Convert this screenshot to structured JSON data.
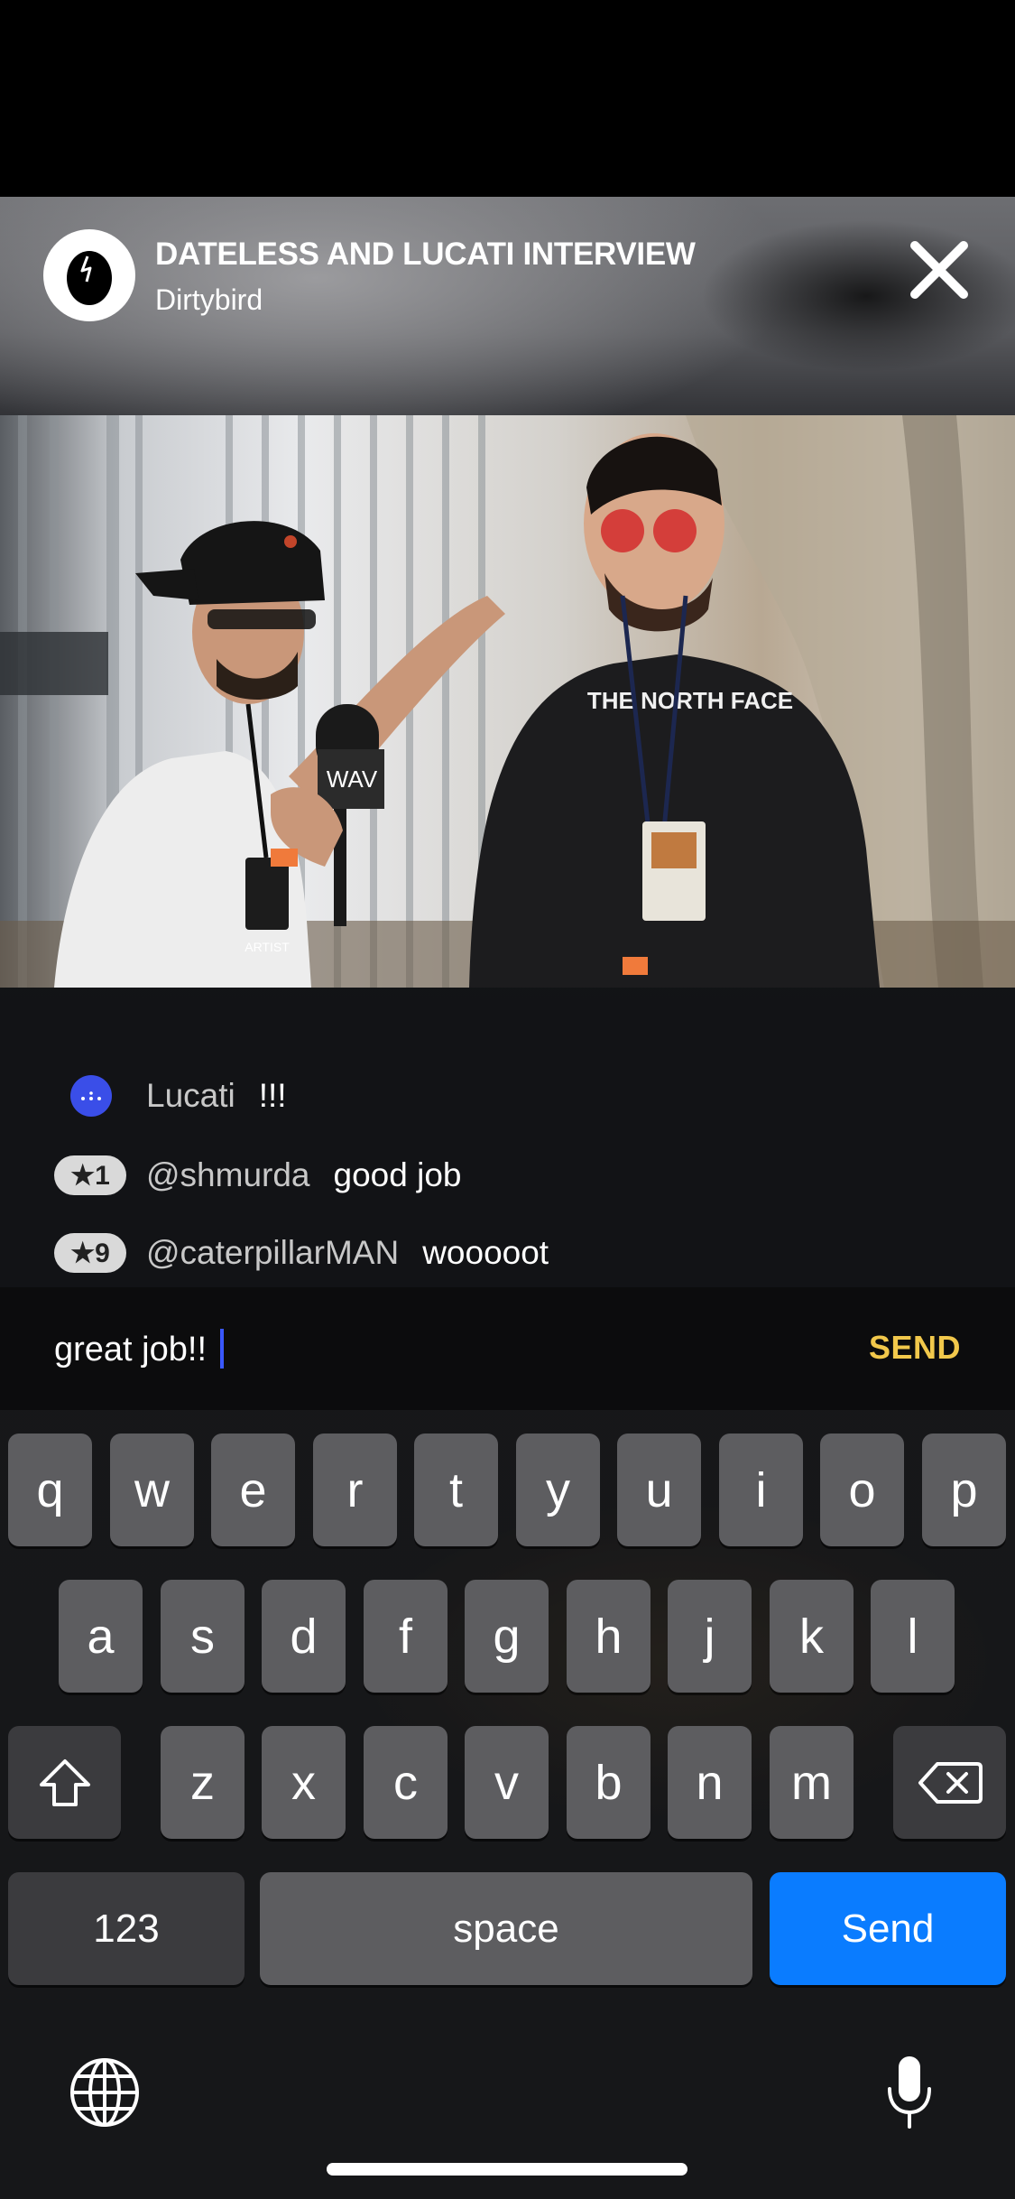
{
  "header": {
    "title": "DATELESS AND LUCATI INTERVIEW",
    "channel": "Dirtybird",
    "close_icon": "close-icon"
  },
  "video": {
    "mic_label": "WAV",
    "pass_label": "ARTIST",
    "shirt_text": "THE NORTH FACE"
  },
  "chat": {
    "messages": [
      {
        "badge_type": "host-dot",
        "badge": "",
        "author": "Lucati",
        "text": "!!!"
      },
      {
        "badge_type": "star",
        "badge": "★1",
        "author": "@shmurda",
        "text": "good job"
      },
      {
        "badge_type": "star",
        "badge": "★9",
        "author": "@caterpillarMAN",
        "text": "wooooot"
      }
    ]
  },
  "composer": {
    "value": "great job!!",
    "send_label": "SEND"
  },
  "keyboard": {
    "row1": [
      "q",
      "w",
      "e",
      "r",
      "t",
      "y",
      "u",
      "i",
      "o",
      "p"
    ],
    "row2": [
      "a",
      "s",
      "d",
      "f",
      "g",
      "h",
      "j",
      "k",
      "l"
    ],
    "row3": [
      "z",
      "x",
      "c",
      "v",
      "b",
      "n",
      "m"
    ],
    "numbers_label": "123",
    "space_label": "space",
    "send_label": "Send"
  },
  "colors": {
    "accent_send": "#f2c84b",
    "keyboard_send": "#0a7cff",
    "host_badge": "#3a4ee8"
  }
}
